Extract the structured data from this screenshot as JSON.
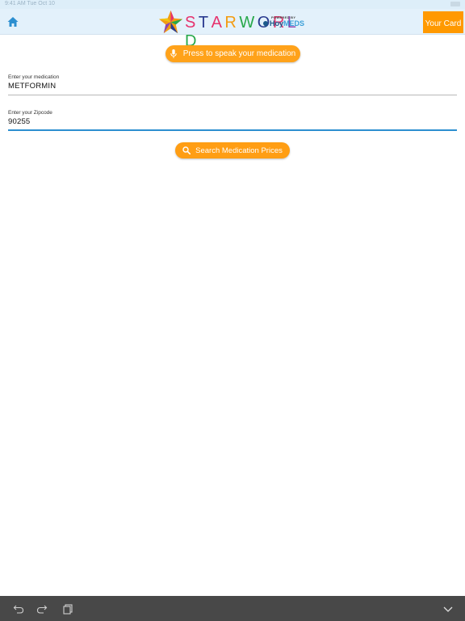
{
  "status_bar": {
    "left_text": "9:41 AM  Tue Oct 10"
  },
  "header": {
    "home_icon": "home-icon",
    "logo": {
      "letters": [
        "S",
        "T",
        "A",
        "R",
        "W",
        "O",
        "R",
        "L",
        "D"
      ],
      "letter_colors": [
        "#e6336e",
        "#2a3b8f",
        "#e6336e",
        "#f39c12",
        "#27a84a",
        "#2a3b8f",
        "#e6336e",
        "#8e44ad",
        "#27a84a"
      ],
      "powered_by": "POWERED BY",
      "brand_a": "Hoy",
      "brand_b": "MEDS"
    },
    "card_button": "Your Card"
  },
  "speak_button": {
    "label": "Press to speak your medication",
    "icon": "microphone-icon"
  },
  "medication_field": {
    "label": "Enter your medication",
    "value": "METFORMIN"
  },
  "zipcode_field": {
    "label": "Enter your Zipcode",
    "value": "90255"
  },
  "search_button": {
    "label": "Search Medication Prices",
    "icon": "search-icon"
  },
  "colors": {
    "accent": "#ff9900",
    "focus": "#2c8fd0",
    "header_bg": "#e3f1fb",
    "toolbar_bg": "#484848"
  },
  "bottom_bar": {
    "icons": [
      "undo-icon",
      "redo-icon",
      "copy-icon",
      "chevron-down-icon"
    ]
  }
}
